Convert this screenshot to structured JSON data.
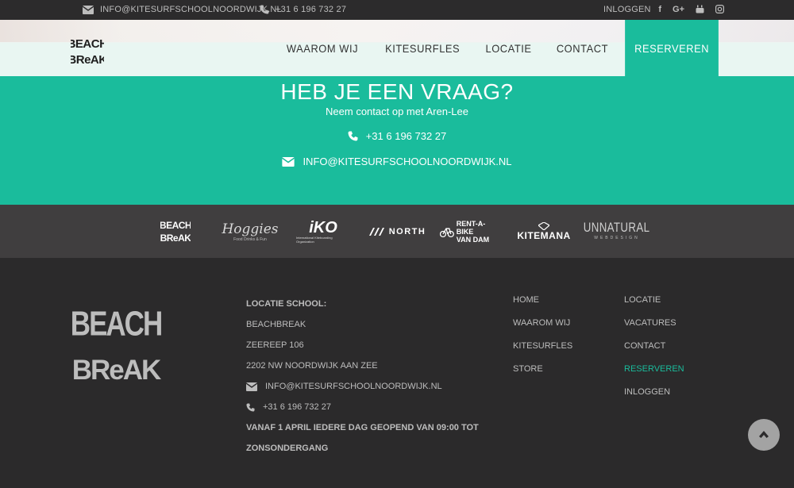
{
  "topbar": {
    "email": "INFO@KITESURFSCHOOLNOORDWIJK.NL",
    "phone": "+31 6 196 732 27",
    "login": "INLOGGEN",
    "social": [
      {
        "name": "facebook-icon",
        "glyph": "f"
      },
      {
        "name": "google-plus-icon",
        "glyph": "G+"
      },
      {
        "name": "youtube-icon",
        "glyph": "▶"
      },
      {
        "name": "instagram-icon",
        "glyph": "◎"
      }
    ]
  },
  "header": {
    "logo_text": "BEACH BREAK",
    "nav": [
      {
        "label": "WAAROM WIJ",
        "active": false
      },
      {
        "label": "KITESURFLES",
        "active": false
      },
      {
        "label": "LOCATIE",
        "active": false
      },
      {
        "label": "CONTACT",
        "active": false
      },
      {
        "label": "RESERVEREN",
        "active": true
      }
    ]
  },
  "contact": {
    "title": "HEB JE EEN VRAAG?",
    "subtitle": "Neem contact op met Aren-Lee",
    "phone": "+31 6 196 732 27",
    "email": "INFO@KITESURFSCHOOLNOORDWIJK.NL"
  },
  "partners": {
    "beachbreak": "BEACH BREAK",
    "hoggies": "Hoggies",
    "hoggies_sub": "Food Drinks & Fun",
    "iko": "iKO",
    "iko_sub": "International Kiteboarding Organization",
    "north": "NORTH",
    "rentabike": "RENT-A-BIKE",
    "rentabike_sub": "VAN DAM",
    "kitemana": "KITEMANA",
    "unnatural": "UNNATURAL",
    "unnatural_sub": "WEBDESIGN"
  },
  "footer": {
    "logo_text": "BEACH BREAK",
    "location_heading": "LOCATIE SCHOOL:",
    "name": "BEACHBREAK",
    "street": "ZEEREEP 106",
    "city": "2202 NW NOORDWIJK AAN ZEE",
    "email": "INFO@KITESURFSCHOOLNOORDWIJK.NL",
    "phone": "+31 6 196 732 27",
    "hours_1": "VANAF 1 APRIL IEDERE DAG GEOPEND VAN 09:00 TOT",
    "hours_2": "ZONSONDERGANG",
    "links_col1": [
      "HOME",
      "WAAROM WIJ",
      "KITESURFLES",
      "STORE"
    ],
    "links_col2": [
      "LOCATIE",
      "VACATURES",
      "CONTACT",
      "RESERVEREN",
      "INLOGGEN"
    ],
    "active_link": "RESERVEREN"
  },
  "colors": {
    "accent": "#1abc9c",
    "dark": "#2b2a2b",
    "partners_bg": "#403e3f"
  }
}
